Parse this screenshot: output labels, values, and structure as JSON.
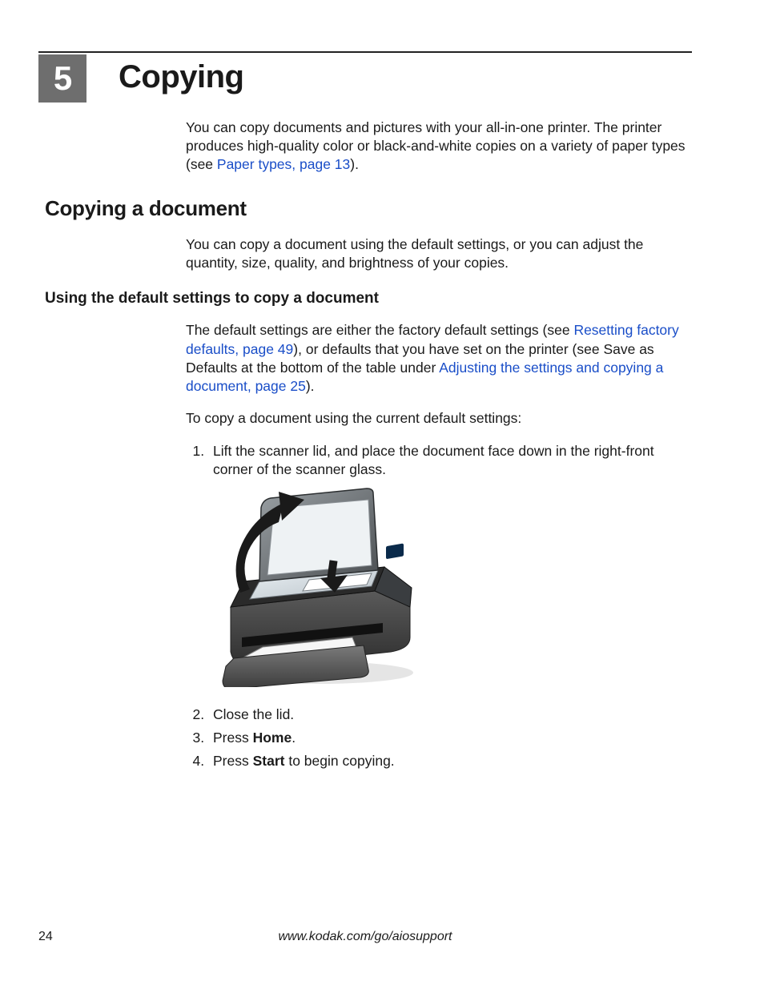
{
  "chapter": {
    "number": "5",
    "title": "Copying"
  },
  "intro": {
    "text_before_link": "You can copy documents and pictures with your all-in-one printer. The printer produces high-quality color or black-and-white copies on a variety of paper types (see ",
    "link": "Paper types, page 13",
    "text_after_link": ")."
  },
  "h2": "Copying a document",
  "p_h2": "You can copy a document using the default settings, or you can adjust the quantity, size, quality, and brightness of your copies.",
  "h3": "Using the default settings to copy a document",
  "p_h3": {
    "part1": "The default settings are either the factory default settings (see ",
    "link1": "Resetting factory defaults, page 49",
    "part2": "), or defaults that you have set on the printer (see Save as Defaults at the bottom of the table under ",
    "link2": "Adjusting the settings and copying a document, page 25",
    "part3": ")."
  },
  "p_lead": "To copy a document using the current default settings:",
  "steps": {
    "s1": "Lift the scanner lid, and place the document face down in the right-front corner of the scanner glass.",
    "s2": "Close the lid.",
    "s3_pre": "Press ",
    "s3_bold": "Home",
    "s3_post": ".",
    "s4_pre": "Press ",
    "s4_bold": "Start",
    "s4_post": " to begin copying."
  },
  "footer": {
    "page": "24",
    "url": "www.kodak.com/go/aiosupport"
  }
}
